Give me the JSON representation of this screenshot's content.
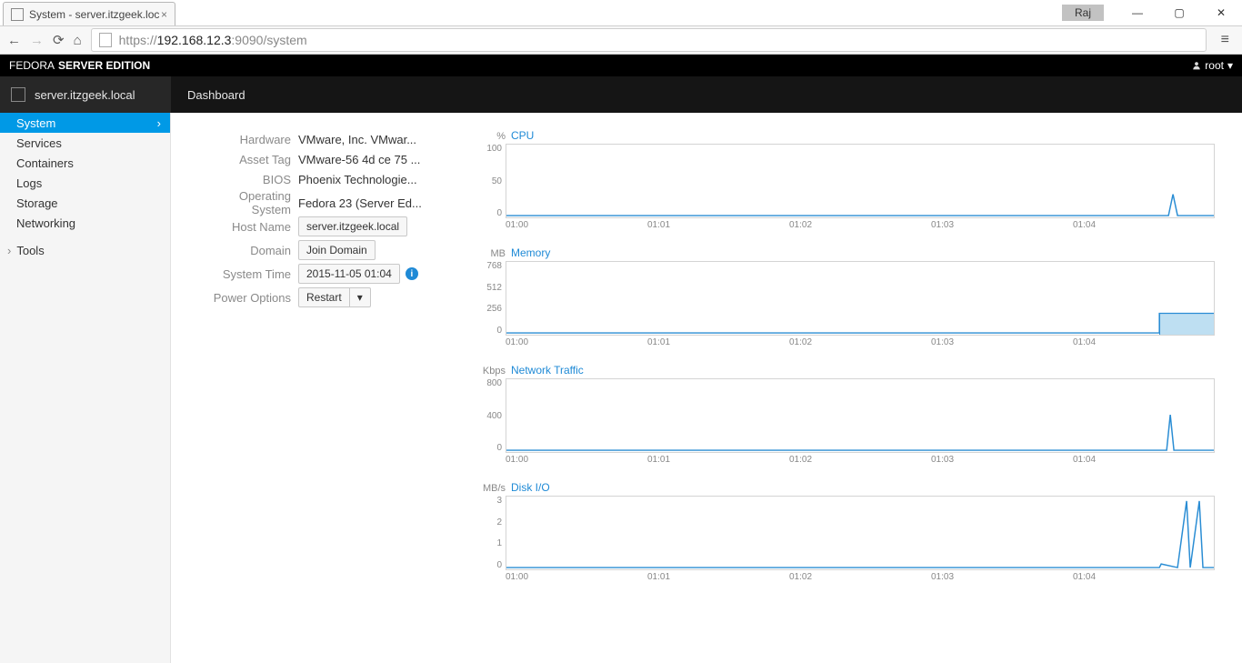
{
  "browser": {
    "tab_title": "System - server.itzgeek.loc",
    "user_badge": "Raj",
    "url_prefix": "https://",
    "url_host": "192.168.12.3",
    "url_rest": ":9090/system"
  },
  "brand": {
    "thin": "FEDORA",
    "bold": "SERVER EDITION",
    "user": "root"
  },
  "host": "server.itzgeek.local",
  "dashboard_label": "Dashboard",
  "sidebar": {
    "items": [
      "System",
      "Services",
      "Containers",
      "Logs",
      "Storage",
      "Networking"
    ],
    "tools": "Tools",
    "active_index": 0
  },
  "info": {
    "hardware_lbl": "Hardware",
    "hardware": "VMware, Inc. VMwar...",
    "assettag_lbl": "Asset Tag",
    "assettag": "VMware-56 4d ce 75 ...",
    "bios_lbl": "BIOS",
    "bios": "Phoenix Technologie...",
    "os_lbl": "Operating System",
    "os": "Fedora 23 (Server Ed...",
    "hostname_lbl": "Host Name",
    "hostname": "server.itzgeek.local",
    "domain_lbl": "Domain",
    "domain_btn": "Join Domain",
    "time_lbl": "System Time",
    "time": "2015-11-05 01:04",
    "power_lbl": "Power Options",
    "power_btn": "Restart",
    "power_caret": "▾"
  },
  "chart_data": [
    {
      "type": "line",
      "title": "CPU",
      "unit": "%",
      "x_ticks": [
        "01:00",
        "01:01",
        "01:02",
        "01:03",
        "01:04"
      ],
      "y_ticks": [
        "100",
        "50",
        "0"
      ],
      "ylim": [
        0,
        100
      ],
      "series": [
        {
          "name": "cpu",
          "values_est": "flat ~0 with brief spike to ~30 near 01:04"
        }
      ]
    },
    {
      "type": "area",
      "title": "Memory",
      "unit": "MB",
      "x_ticks": [
        "01:00",
        "01:01",
        "01:02",
        "01:03",
        "01:04"
      ],
      "y_ticks": [
        "768",
        "512",
        "256",
        "0"
      ],
      "ylim": [
        0,
        768
      ],
      "series": [
        {
          "name": "mem",
          "values_est": "flat ~0 then step to ~200 after 01:04"
        }
      ]
    },
    {
      "type": "line",
      "title": "Network Traffic",
      "unit": "Kbps",
      "x_ticks": [
        "01:00",
        "01:01",
        "01:02",
        "01:03",
        "01:04"
      ],
      "y_ticks": [
        "800",
        "400",
        "0"
      ],
      "ylim": [
        0,
        800
      ],
      "series": [
        {
          "name": "net",
          "values_est": "flat ~0 with brief spike to ~400 near 01:04"
        }
      ]
    },
    {
      "type": "line",
      "title": "Disk I/O",
      "unit": "MB/s",
      "x_ticks": [
        "01:00",
        "01:01",
        "01:02",
        "01:03",
        "01:04"
      ],
      "y_ticks": [
        "3",
        "2",
        "1",
        "0"
      ],
      "ylim": [
        0,
        3
      ],
      "series": [
        {
          "name": "disk",
          "values_est": "flat ~0 with two sharp spikes to ~3 after 01:04"
        }
      ]
    }
  ]
}
